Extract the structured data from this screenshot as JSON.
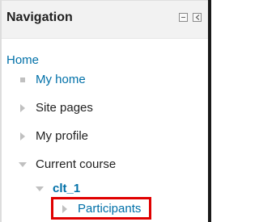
{
  "block": {
    "title": "Navigation",
    "controls": {
      "minimize_icon": "minimize-icon",
      "dock_icon": "dock-left-icon"
    }
  },
  "nav": {
    "home": "Home",
    "items": [
      {
        "label": "My home",
        "marker": "bullet",
        "style": "link"
      },
      {
        "label": "Site pages",
        "marker": "collapsed-arrow",
        "style": "plain"
      },
      {
        "label": "My profile",
        "marker": "collapsed-arrow",
        "style": "plain"
      },
      {
        "label": "Current course",
        "marker": "expanded-arrow",
        "style": "plain"
      },
      {
        "label": "clt_1",
        "marker": "expanded-arrow",
        "style": "bold-link"
      },
      {
        "label": "Participants",
        "marker": "collapsed-arrow",
        "style": "link",
        "highlighted": true
      }
    ]
  },
  "colors": {
    "link": "#0070a8",
    "text": "#222222",
    "header_bg": "#f2f2f2",
    "marker": "#c0c0c0",
    "highlight_border": "#e00000"
  }
}
